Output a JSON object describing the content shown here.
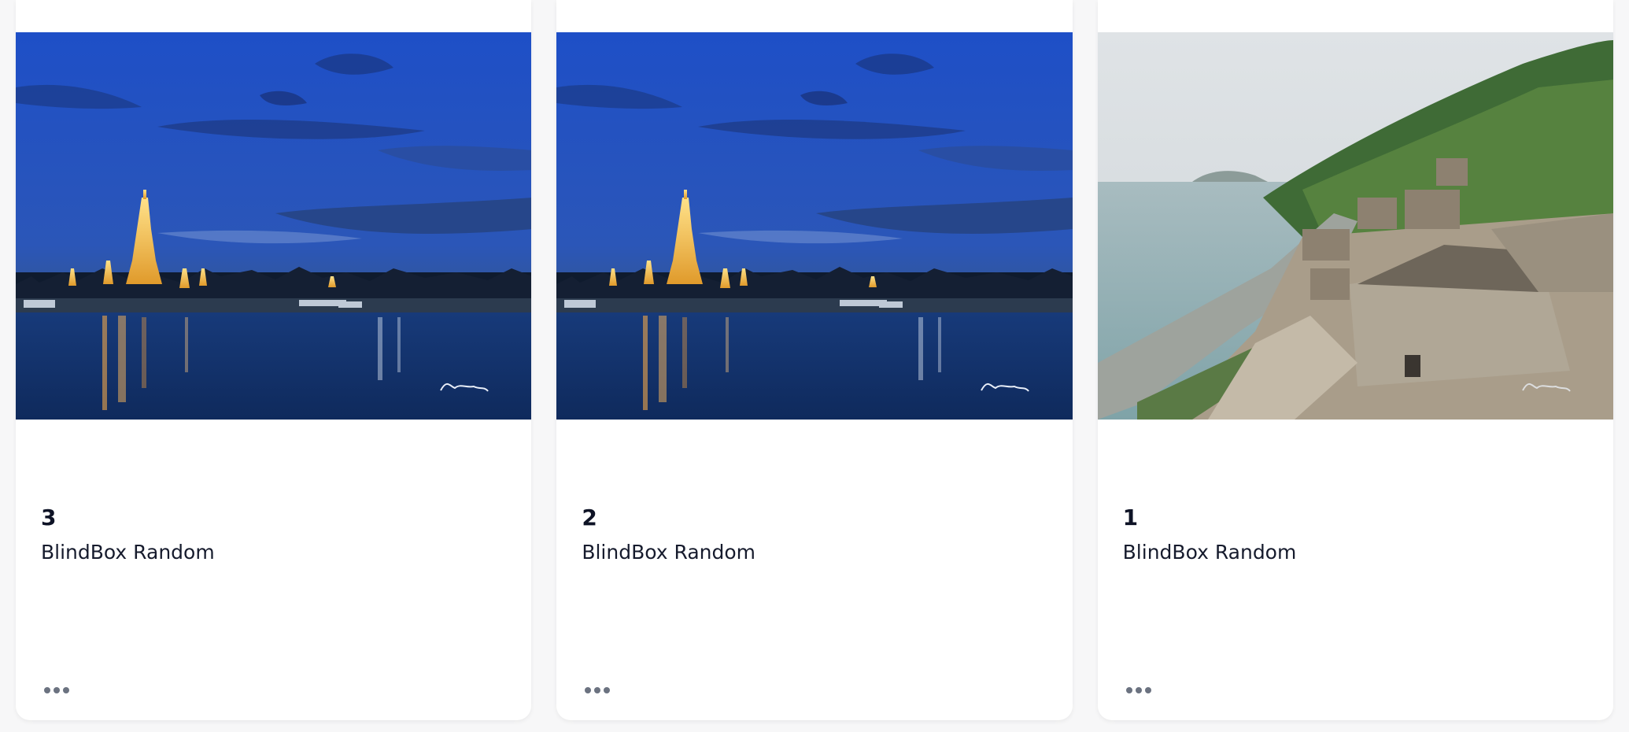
{
  "cards": [
    {
      "number": "3",
      "title": "BlindBox Random",
      "image": "temple-at-dusk-river"
    },
    {
      "number": "2",
      "title": "BlindBox Random",
      "image": "temple-at-dusk-river"
    },
    {
      "number": "1",
      "title": "BlindBox Random",
      "image": "coastal-stone-village"
    }
  ],
  "icons": {
    "more": "more-horizontal-icon"
  }
}
